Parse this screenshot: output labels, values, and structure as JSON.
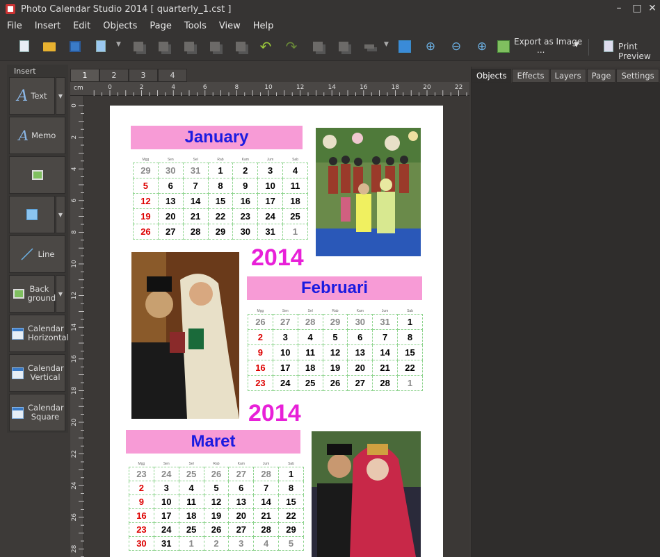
{
  "window": {
    "title": "Photo Calendar Studio 2014 [ quarterly_1.cst ]",
    "min": "–",
    "max": "□",
    "close": "✕"
  },
  "menu": [
    "File",
    "Insert",
    "Edit",
    "Objects",
    "Page",
    "Tools",
    "View",
    "Help"
  ],
  "toolbar": {
    "export_label": "Export as Image",
    "export_dots": "...",
    "print_label": "Print Preview"
  },
  "insert_panel": {
    "title": "Insert",
    "items": [
      {
        "label": "Text"
      },
      {
        "label": "Memo"
      },
      {
        "label": ""
      },
      {
        "label": ""
      },
      {
        "label": "Line"
      },
      {
        "label": "Back ground"
      },
      {
        "label": "Calendar Horizontal"
      },
      {
        "label": "Calendar Vertical"
      },
      {
        "label": "Calendar Square"
      }
    ]
  },
  "page_tabs": [
    "1",
    "2",
    "3",
    "4"
  ],
  "ruler": {
    "unit": "cm",
    "top_ticks": [
      "0",
      "2",
      "4",
      "6",
      "8",
      "10",
      "12",
      "14",
      "16",
      "18",
      "20",
      "22"
    ],
    "left_ticks": [
      "0",
      "2",
      "4",
      "6",
      "8",
      "10",
      "12",
      "14",
      "16",
      "18",
      "20",
      "22",
      "24",
      "26",
      "28"
    ]
  },
  "right_tabs": [
    "Objects",
    "Effects",
    "Layers",
    "Page",
    "Settings"
  ],
  "calendar_page": {
    "weekday_headers": [
      "Mgg",
      "Sen",
      "Sel",
      "Rab",
      "Kam",
      "Jum",
      "Sab"
    ],
    "months": [
      {
        "name": "January",
        "rows": [
          [
            "29",
            "30",
            "31",
            "1",
            "2",
            "3",
            "4"
          ],
          [
            "5",
            "6",
            "7",
            "8",
            "9",
            "10",
            "11"
          ],
          [
            "12",
            "13",
            "14",
            "15",
            "16",
            "17",
            "18"
          ],
          [
            "19",
            "20",
            "21",
            "22",
            "23",
            "24",
            "25"
          ],
          [
            "26",
            "27",
            "28",
            "29",
            "30",
            "31",
            "1"
          ]
        ],
        "gray": [
          [
            0,
            0
          ],
          [
            0,
            1
          ],
          [
            0,
            2
          ],
          [
            4,
            6
          ]
        ]
      },
      {
        "name": "Februari",
        "year": "2014",
        "rows": [
          [
            "26",
            "27",
            "28",
            "29",
            "30",
            "31",
            "1"
          ],
          [
            "2",
            "3",
            "4",
            "5",
            "6",
            "7",
            "8"
          ],
          [
            "9",
            "10",
            "11",
            "12",
            "13",
            "14",
            "15"
          ],
          [
            "16",
            "17",
            "18",
            "19",
            "20",
            "21",
            "22"
          ],
          [
            "23",
            "24",
            "25",
            "26",
            "27",
            "28",
            "1"
          ]
        ],
        "gray": [
          [
            0,
            0
          ],
          [
            0,
            1
          ],
          [
            0,
            2
          ],
          [
            0,
            3
          ],
          [
            0,
            4
          ],
          [
            0,
            5
          ],
          [
            4,
            6
          ]
        ]
      },
      {
        "name": "Maret",
        "year": "2014",
        "rows": [
          [
            "23",
            "24",
            "25",
            "26",
            "27",
            "28",
            "1"
          ],
          [
            "2",
            "3",
            "4",
            "5",
            "6",
            "7",
            "8"
          ],
          [
            "9",
            "10",
            "11",
            "12",
            "13",
            "14",
            "15"
          ],
          [
            "16",
            "17",
            "18",
            "19",
            "20",
            "21",
            "22"
          ],
          [
            "23",
            "24",
            "25",
            "26",
            "27",
            "28",
            "29"
          ],
          [
            "30",
            "31",
            "1",
            "2",
            "3",
            "4",
            "5"
          ]
        ],
        "gray": [
          [
            0,
            0
          ],
          [
            0,
            1
          ],
          [
            0,
            2
          ],
          [
            0,
            3
          ],
          [
            0,
            4
          ],
          [
            0,
            5
          ],
          [
            5,
            2
          ],
          [
            5,
            3
          ],
          [
            5,
            4
          ],
          [
            5,
            5
          ],
          [
            5,
            6
          ]
        ]
      }
    ]
  },
  "colors": {
    "month_band": "#f79bd6",
    "month_text": "#1b1be0",
    "year_text": "#e820d8",
    "sunday": "#dd0000",
    "grid": "#8fd48f"
  }
}
